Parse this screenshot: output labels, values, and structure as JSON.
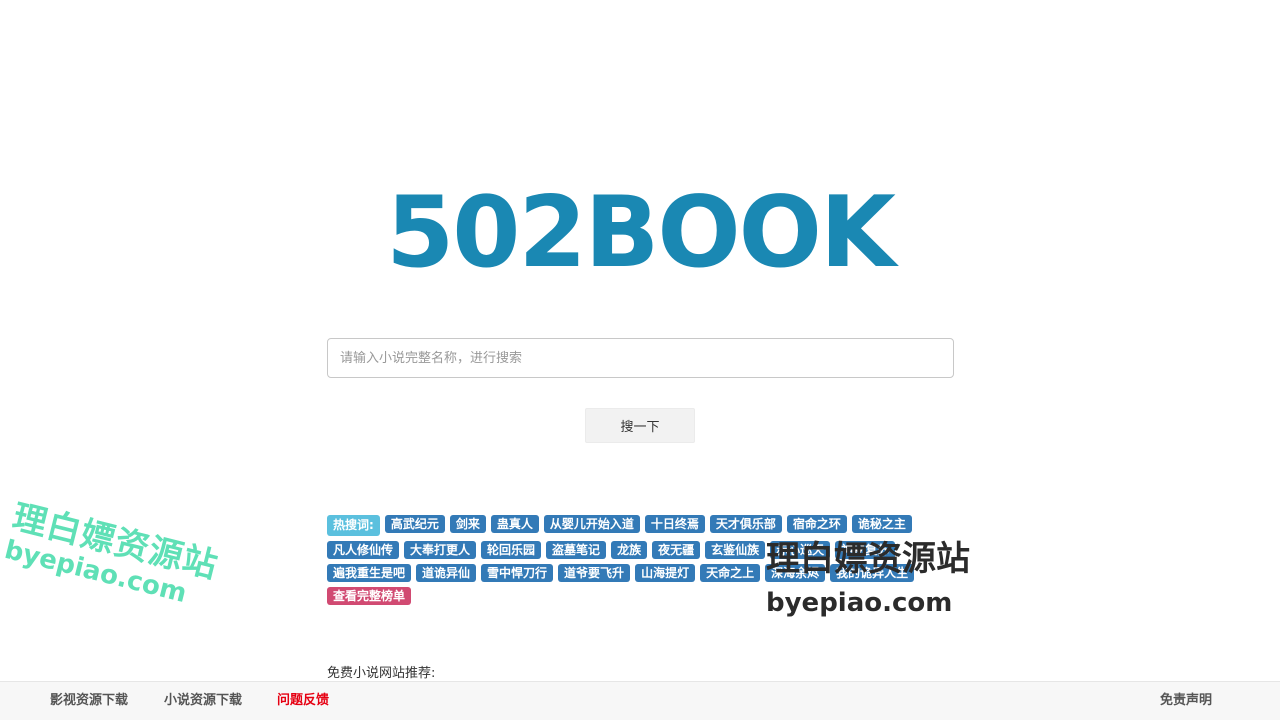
{
  "logo": {
    "text": "502BOOK"
  },
  "search": {
    "placeholder": "请输入小说完整名称，进行搜索",
    "value": "",
    "button_label": "搜一下"
  },
  "hot": {
    "label": "热搜词:",
    "tags": [
      "高武纪元",
      "剑来",
      "蛊真人",
      "从婴儿开始入道",
      "十日终焉",
      "天才俱乐部",
      "宿命之环",
      "诡秘之主",
      "凡人修仙传",
      "大奉打更人",
      "轮回乐园",
      "盗墓笔记",
      "龙族",
      "夜无疆",
      "玄鉴仙族",
      "赤心巡天",
      "神秘复苏",
      "遍我重生是吧",
      "道诡异仙",
      "雪中悍刀行",
      "道爷要飞升",
      "山海提灯",
      "天命之上",
      "深海余烬",
      "我的诡异人生"
    ],
    "full_list_label": "查看完整榜单"
  },
  "friends": {
    "label": "免费小说网站推荐:"
  },
  "watermarks": {
    "left_cn": "理白嫖资源站",
    "left_en": "byepiao.com",
    "right_cn": "理白嫖资源站",
    "right_en": "byepiao.com"
  },
  "footer": {
    "video_download": "影视资源下载",
    "novel_download": "小说资源下载",
    "feedback": "问题反馈",
    "disclaimer": "免责声明"
  },
  "colors": {
    "logo": "#1a88b3",
    "tag": "#337ab7",
    "tag_label": "#5bc0de",
    "full_list": "#d14a72",
    "feedback": "#e60012"
  }
}
